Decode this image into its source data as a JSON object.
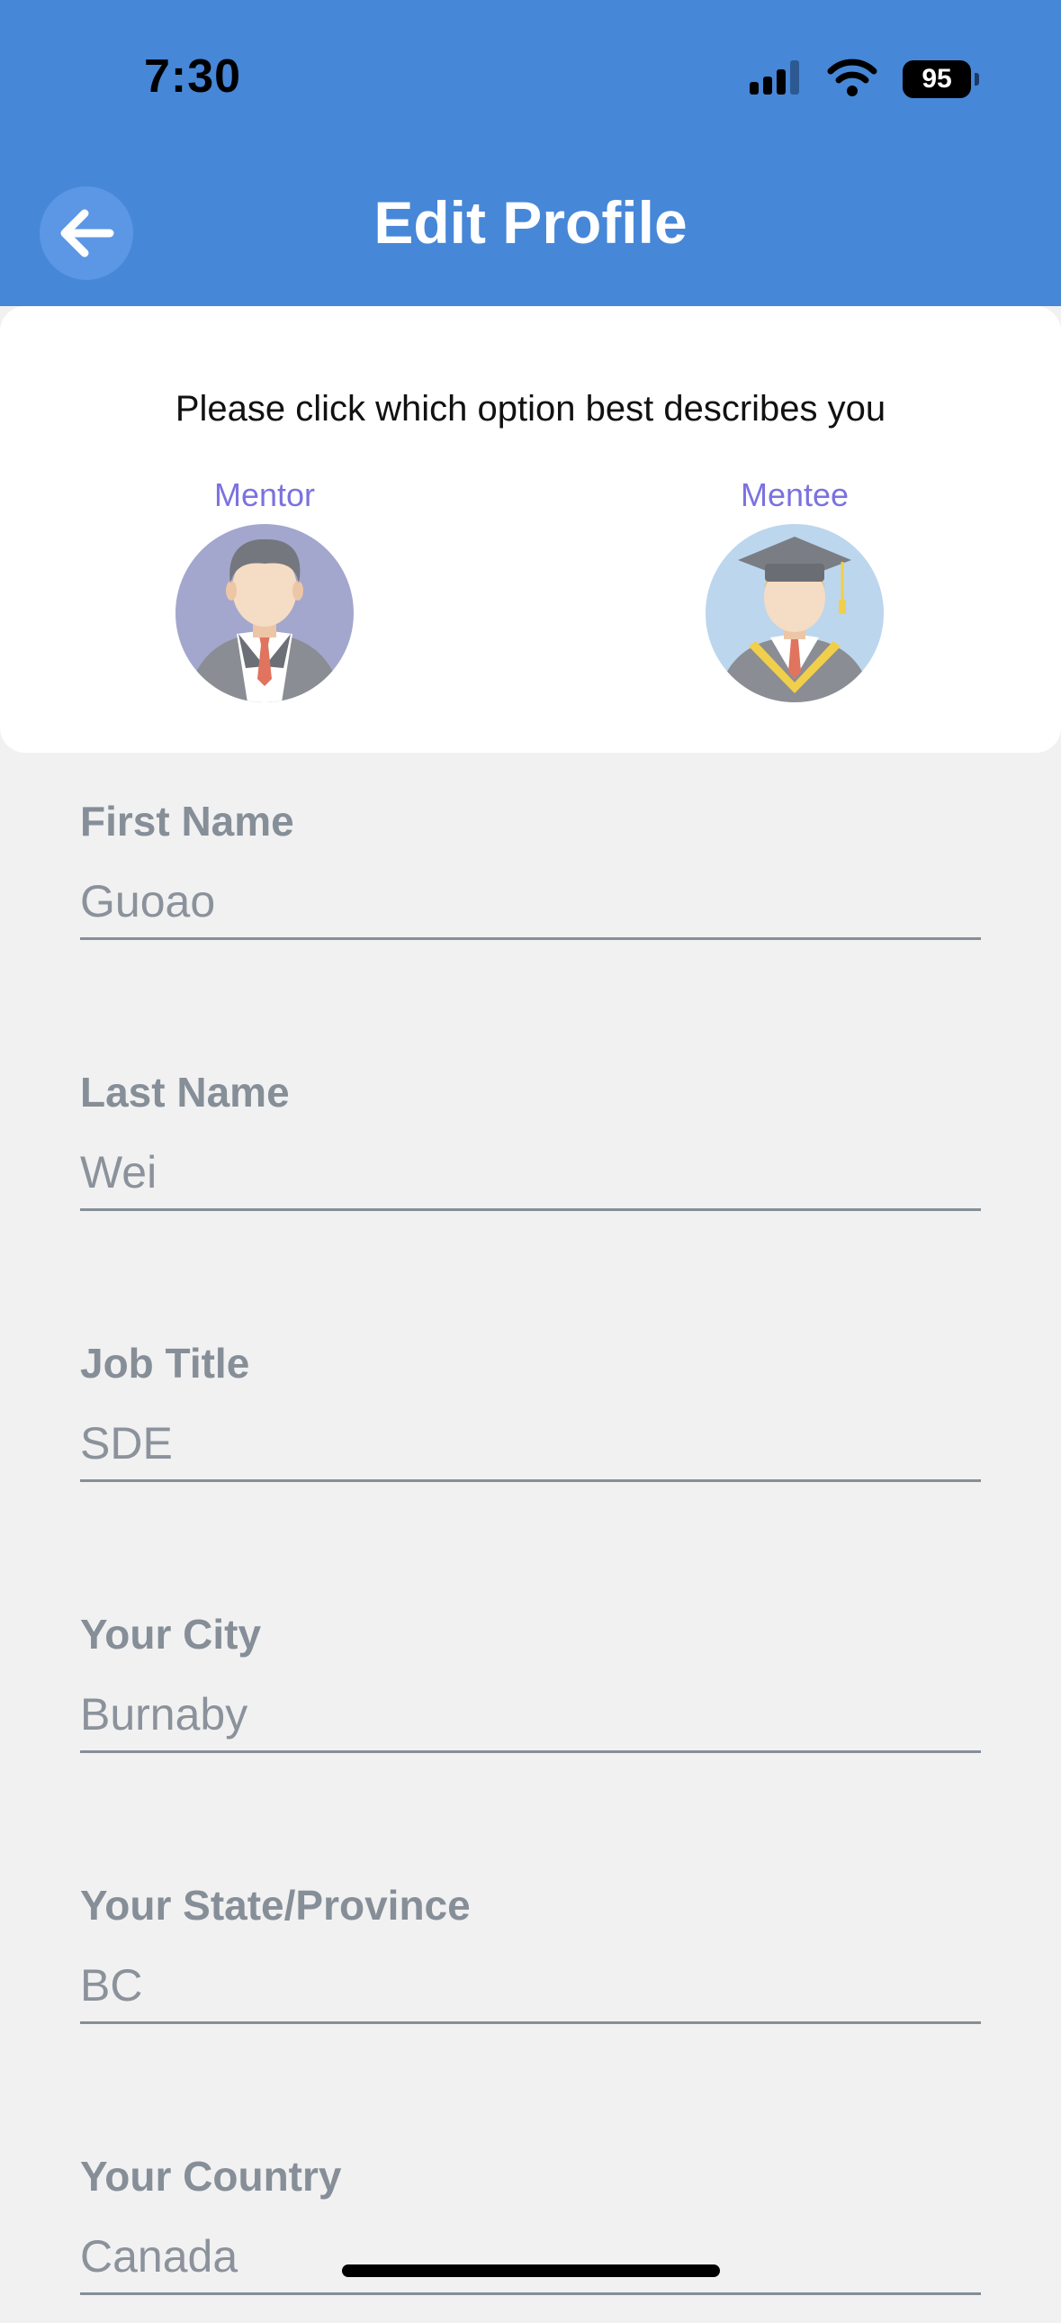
{
  "status_bar": {
    "time": "7:30",
    "battery": "95",
    "icons": [
      "signal-icon",
      "wifi-icon",
      "battery-icon"
    ]
  },
  "header": {
    "title": "Edit Profile",
    "back_icon": "arrow-left-icon",
    "background_color": "#4687d8"
  },
  "role_selector": {
    "prompt": "Please click which option best describes you",
    "options": [
      {
        "label": "Mentor",
        "icon": "mentor-avatar-icon"
      },
      {
        "label": "Mentee",
        "icon": "mentee-graduate-avatar-icon"
      }
    ],
    "label_color": "#7b72e0"
  },
  "form": {
    "fields": [
      {
        "label": "First Name",
        "value": "Guoao"
      },
      {
        "label": "Last Name",
        "value": "Wei"
      },
      {
        "label": "Job Title",
        "value": "SDE"
      },
      {
        "label": "Your City",
        "value": "Burnaby"
      },
      {
        "label": "Your State/Province",
        "value": "BC"
      },
      {
        "label": "Your Country",
        "value": "Canada"
      }
    ]
  }
}
